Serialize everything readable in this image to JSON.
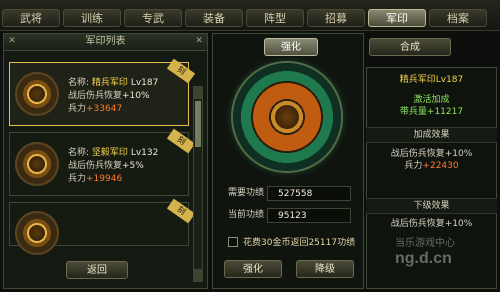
{
  "tabs": [
    "武将",
    "训练",
    "专武",
    "装备",
    "阵型",
    "招募",
    "军印",
    "档案"
  ],
  "activeTab": "军印",
  "leftPanel": {
    "title": "军印列表",
    "cards": [
      {
        "name_label": "名称:",
        "name": "精兵军印",
        "level": "Lv187",
        "effect_label": "战后伤兵恢复",
        "effect_value": "+10%",
        "troop_label": "兵力",
        "troop_value": "+33647",
        "badge": "刻"
      },
      {
        "name_label": "名称:",
        "name": "坚毅军印",
        "level": "Lv132",
        "effect_label": "战后伤兵恢复",
        "effect_value": "+5%",
        "troop_label": "兵力",
        "troop_value": "+19946",
        "badge": "刻"
      }
    ],
    "back_button": "返回"
  },
  "center": {
    "strengthen_tab": "强化",
    "compose_tab": "合成",
    "need_merit_label": "需要功绩",
    "need_merit_value": "527558",
    "current_merit_label": "当前功绩",
    "current_merit_value": "95123",
    "checkbox_text": "花费30金币返回25117功绩",
    "strengthen_button": "强化",
    "downgrade_button": "降级"
  },
  "rightPanel": {
    "name": "精兵军印Lv187",
    "activated": "激活加成",
    "leader": "带兵量+11217",
    "bonus_title": "加成效果",
    "bonus_effect": "战后伤兵恢复+10%",
    "bonus_troop_label": "兵力",
    "bonus_troop_value": "+22430",
    "next_title": "下级效果",
    "next_effect": "战后伤兵恢复+10%"
  },
  "watermark": {
    "cn": "当乐游戏中心",
    "en": "ng.d.cn"
  }
}
